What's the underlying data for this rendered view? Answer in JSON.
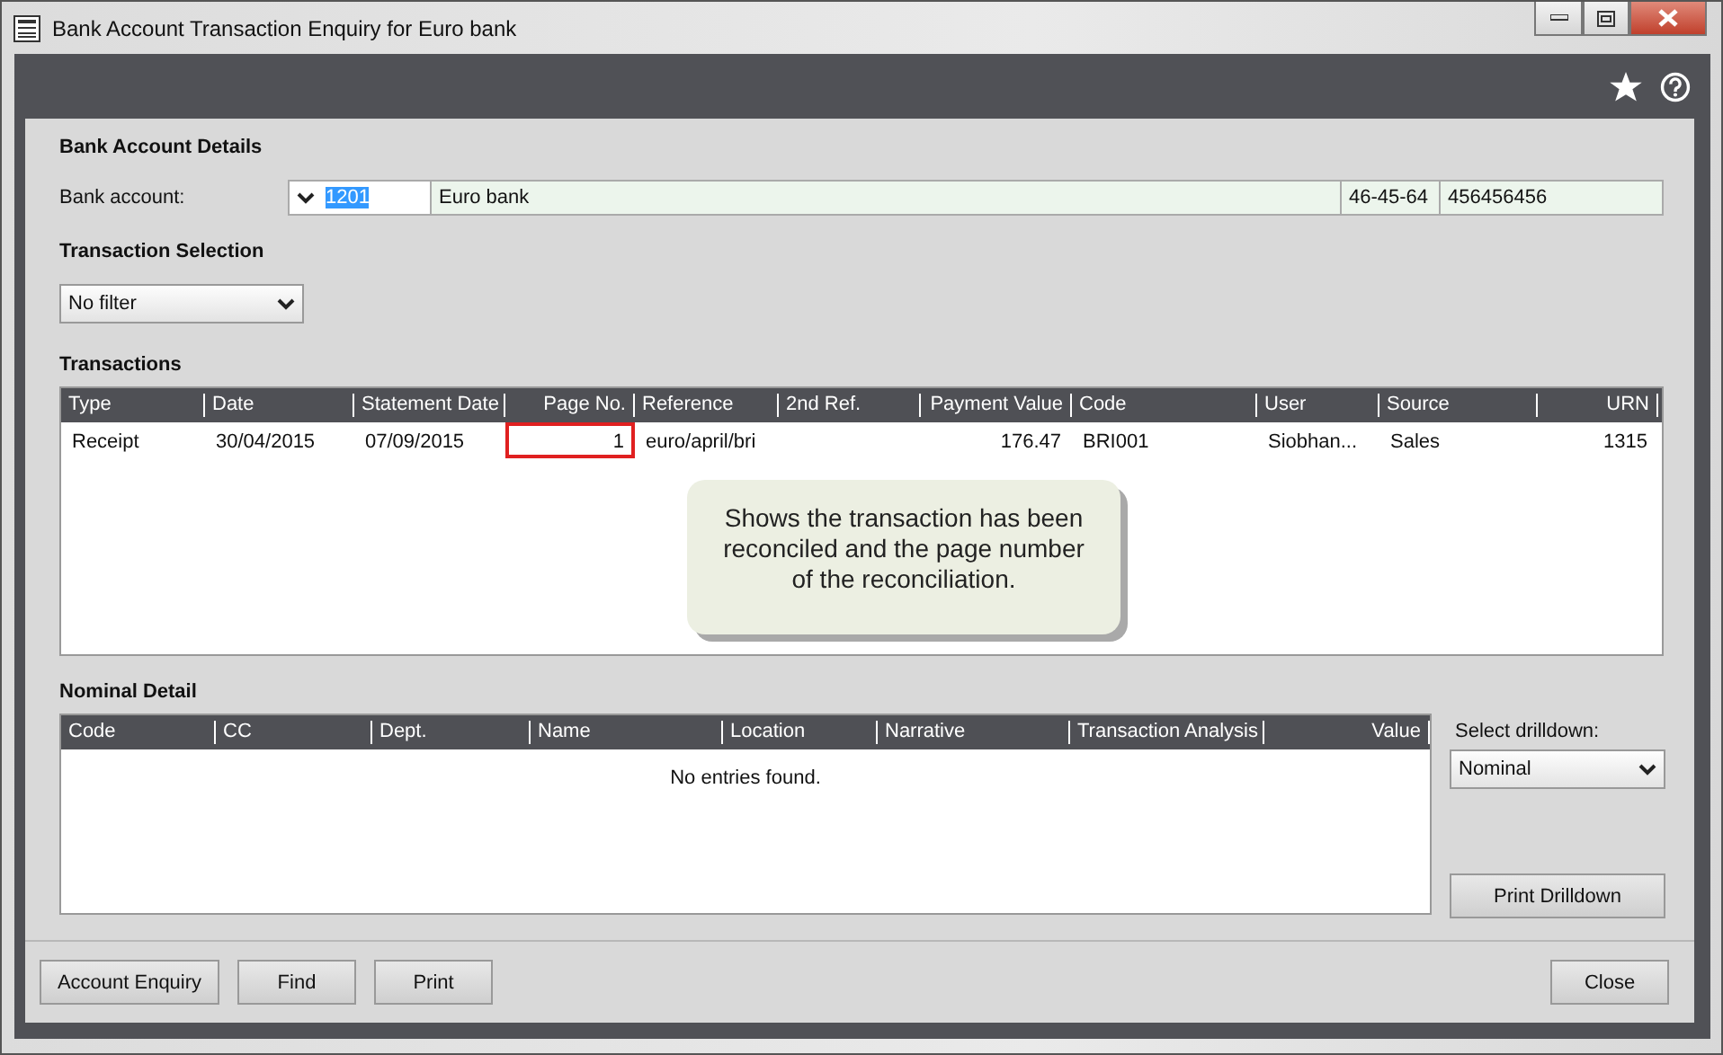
{
  "window": {
    "title": "Bank Account Transaction Enquiry for Euro bank"
  },
  "bank_account_details": {
    "heading": "Bank Account Details",
    "label": "Bank account:",
    "code": "1201",
    "name": "Euro bank",
    "sort_code": "46-45-64",
    "account_number": "456456456"
  },
  "transaction_selection": {
    "heading": "Transaction Selection",
    "filter": "No filter"
  },
  "transactions": {
    "heading": "Transactions",
    "columns": [
      "Type",
      "Date",
      "Statement Date",
      "Page No.",
      "Reference",
      "2nd Ref.",
      "Payment Value",
      "Code",
      "User",
      "Source",
      "URN"
    ],
    "rows": [
      {
        "cells": [
          {
            "text": "Receipt",
            "highlighted": false
          },
          {
            "text": "30/04/2015",
            "highlighted": false
          },
          {
            "text": "07/09/2015",
            "highlighted": false
          },
          {
            "text": "1",
            "highlighted": true
          },
          {
            "text": "euro/april/bri",
            "highlighted": false
          },
          {
            "text": "",
            "highlighted": false
          },
          {
            "text": "176.47",
            "highlighted": false
          },
          {
            "text": "BRI001",
            "highlighted": false
          },
          {
            "text": "Siobhan...",
            "highlighted": false
          },
          {
            "text": "Sales",
            "highlighted": false
          },
          {
            "text": "1315",
            "highlighted": false
          }
        ]
      }
    ]
  },
  "callout": {
    "text": "Shows the transaction has been reconciled and the page number of the reconciliation."
  },
  "nominal_detail": {
    "heading": "Nominal Detail",
    "columns": [
      "Code",
      "CC",
      "Dept.",
      "Name",
      "Location",
      "Narrative",
      "Transaction Analysis",
      "Value"
    ],
    "empty_message": "No entries found.",
    "drilldown_label": "Select drilldown:",
    "drilldown": "Nominal",
    "print_button": "Print Drilldown"
  },
  "footer_buttons": [
    "Account Enquiry",
    "Find",
    "Print"
  ],
  "close_button": "Close"
}
